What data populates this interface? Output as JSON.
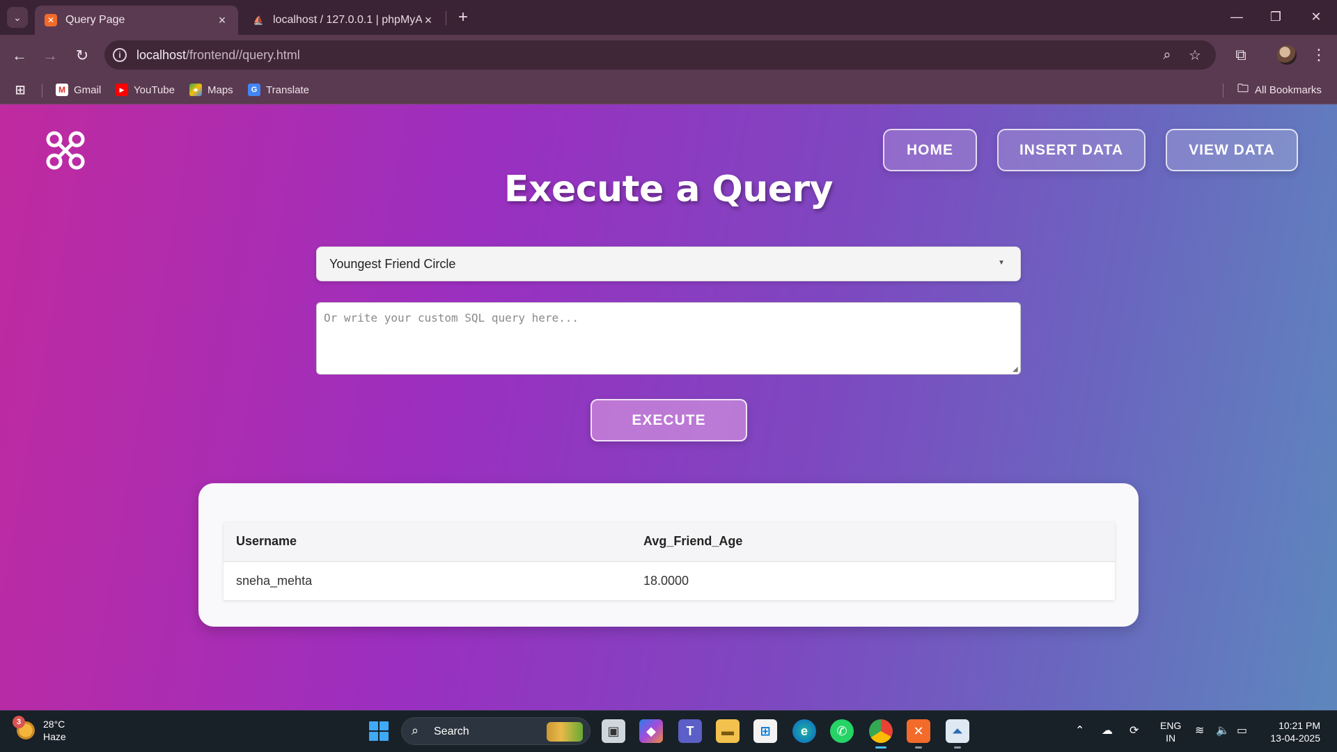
{
  "browser": {
    "tabs": [
      {
        "title": "Query Page",
        "favicon": "xampp-icon",
        "active": true
      },
      {
        "title": "localhost / 127.0.0.1 | phpMyAd",
        "favicon": "phpmyadmin-icon",
        "active": false
      }
    ],
    "url": {
      "host": "localhost",
      "path": "/frontend//query.html"
    },
    "bookmarks": [
      {
        "label": "Gmail",
        "icon": "gmail-icon"
      },
      {
        "label": "YouTube",
        "icon": "youtube-icon"
      },
      {
        "label": "Maps",
        "icon": "maps-icon"
      },
      {
        "label": "Translate",
        "icon": "translate-icon"
      }
    ],
    "all_bookmarks_label": "All Bookmarks"
  },
  "page": {
    "nav": {
      "home": "HOME",
      "insert": "INSERT DATA",
      "view": "VIEW DATA"
    },
    "title": "Execute a Query",
    "query_select": {
      "selected": "Youngest Friend Circle"
    },
    "sql_input": {
      "value": "",
      "placeholder": "Or write your custom SQL query here..."
    },
    "execute_label": "EXECUTE",
    "results": {
      "columns": [
        "Username",
        "Avg_Friend_Age"
      ],
      "rows": [
        [
          "sneha_mehta",
          "18.0000"
        ]
      ]
    }
  },
  "taskbar": {
    "weather": {
      "temp": "28°C",
      "condition": "Haze",
      "badge": "3"
    },
    "search_label": "Search",
    "language": {
      "line1": "ENG",
      "line2": "IN"
    },
    "clock": {
      "time": "10:21 PM",
      "date": "13-04-2025"
    }
  },
  "colors": {
    "page_gradient_start": "#c02a9f",
    "page_gradient_end": "#5d87bd",
    "chrome_bg": "#5a3a50",
    "taskbar_bg": "#182028"
  }
}
